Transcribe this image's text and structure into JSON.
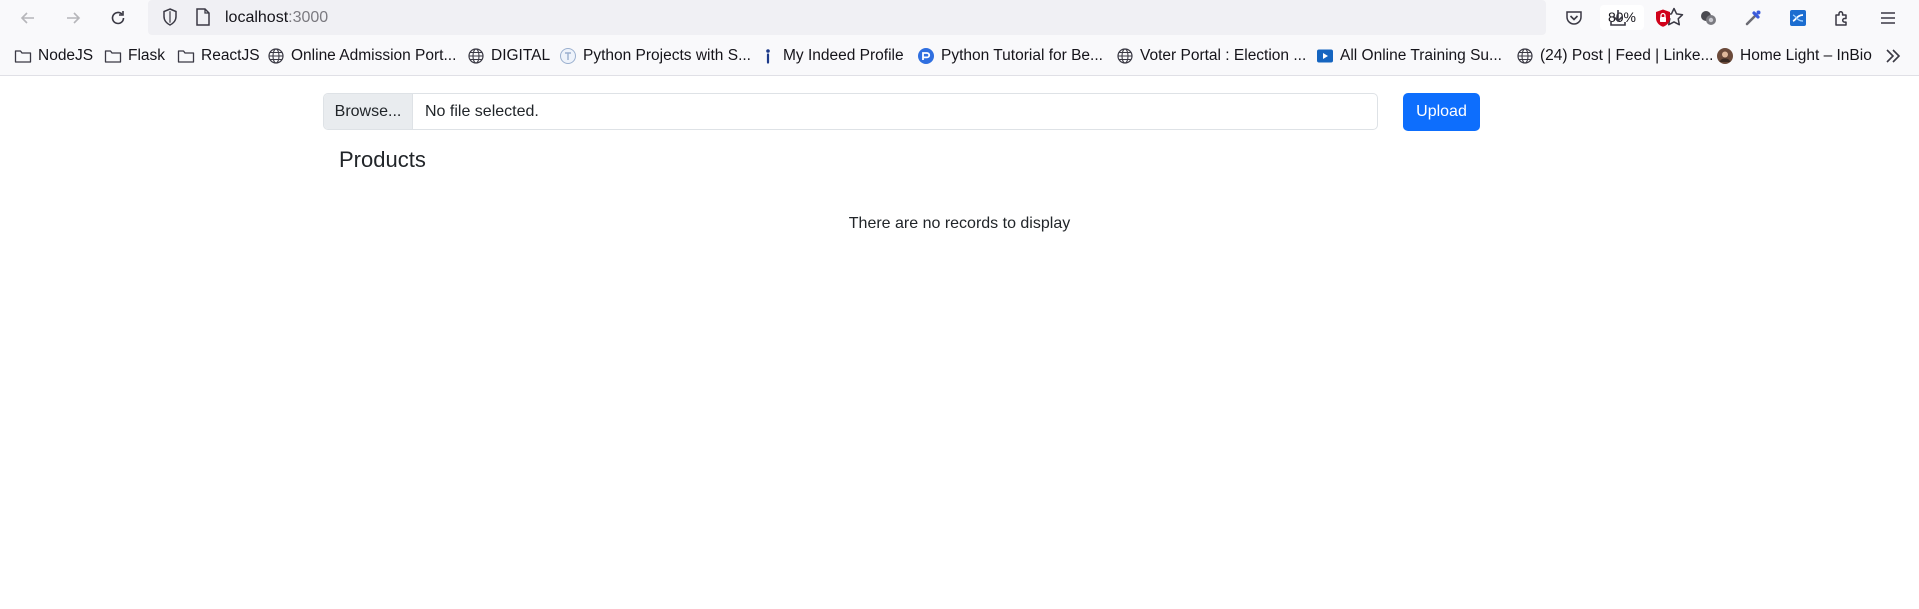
{
  "browser": {
    "url_host": "localhost",
    "url_port": ":3000",
    "zoom_level": "80%",
    "nav_icons": [
      "back-icon",
      "forward-icon",
      "reload-icon"
    ],
    "toolbar_icons": [
      "pocket-icon",
      "download-icon",
      "ublock-icon",
      "extension-circles-icon",
      "dropper-icon",
      "screen-capture-icon",
      "extensions-puzzle-icon",
      "menu-icon"
    ]
  },
  "bookmarks": [
    {
      "label": "NodeJS",
      "icon": "folder-icon"
    },
    {
      "label": "Flask",
      "icon": "folder-icon"
    },
    {
      "label": "ReactJS",
      "icon": "folder-icon"
    },
    {
      "label": "Online Admission Port...",
      "icon": "globe-icon"
    },
    {
      "label": "DIGITAL",
      "icon": "globe-icon"
    },
    {
      "label": "Python Projects with S...",
      "icon": "t-circle-icon"
    },
    {
      "label": "My Indeed Profile",
      "icon": "indeed-icon"
    },
    {
      "label": "Python Tutorial for Be...",
      "icon": "python-tutorial-icon"
    },
    {
      "label": "Voter Portal : Election ...",
      "icon": "globe-icon"
    },
    {
      "label": "All Online Training Su...",
      "icon": "play-icon"
    },
    {
      "label": "(24) Post | Feed | Linke...",
      "icon": "globe-icon"
    },
    {
      "label": "Home Light – InBio",
      "icon": "avatar-icon"
    }
  ],
  "page": {
    "browse_label": "Browse...",
    "file_status": "No file selected.",
    "upload_label": "Upload",
    "title": "Products",
    "empty_message": "There are no records to display"
  },
  "colors": {
    "primary": "#0d6efd",
    "ublock_red": "#d0021b",
    "toolbar_bg": "#f9f9fb",
    "urlbar_bg": "#f0f0f4"
  }
}
